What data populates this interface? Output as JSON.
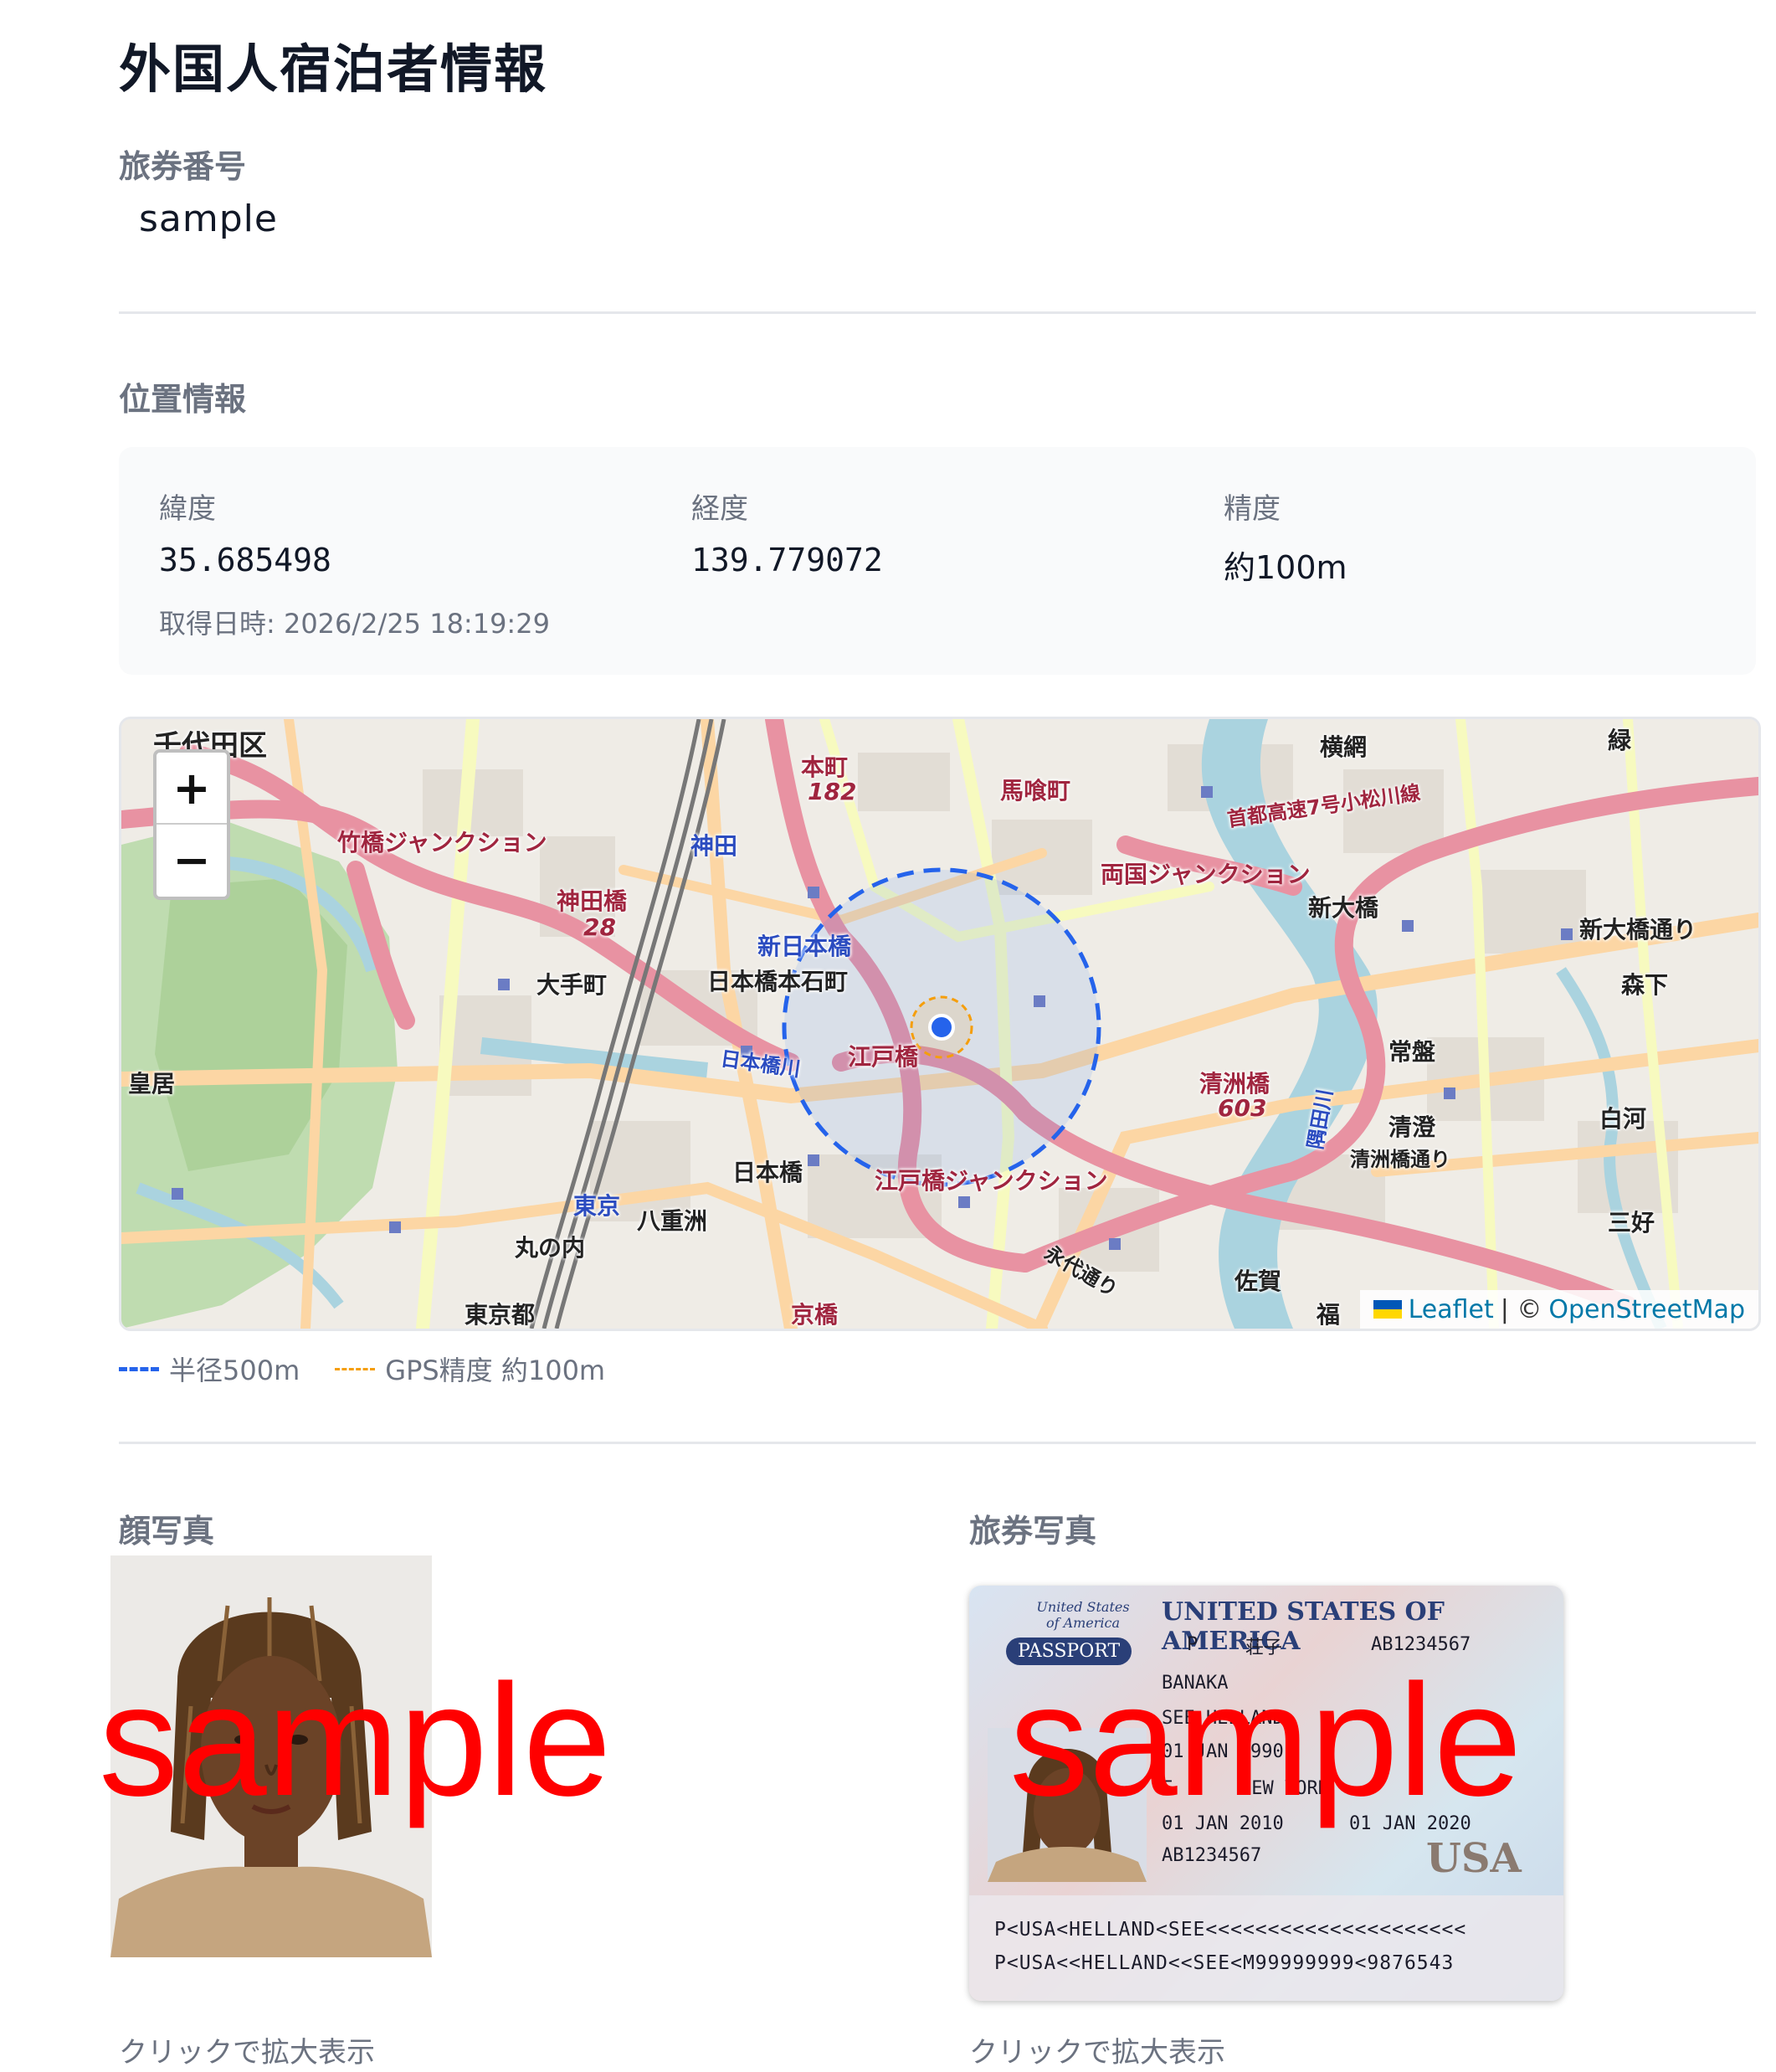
{
  "page": {
    "title": "外国人宿泊者情報"
  },
  "passport_number": {
    "label": "旅券番号",
    "value": "sample"
  },
  "location": {
    "label": "位置情報",
    "latitude_label": "緯度",
    "latitude": "35.685498",
    "longitude_label": "経度",
    "longitude": "139.779072",
    "accuracy_label": "精度",
    "accuracy": "約100m",
    "acquired_at": "取得日時: 2026/2/25 18:19:29"
  },
  "map": {
    "zoom_in": "+",
    "zoom_out": "−",
    "attribution_leaflet": "Leaflet",
    "attribution_sep": "| ©",
    "attribution_osm": "OpenStreetMap",
    "labels": {
      "chiyoda": "千代田区",
      "takebashi_jct": "竹橋ジャンクション",
      "kandabashi": "神田橋",
      "route28": "28",
      "otemachi": "大手町",
      "kokyo": "皇居",
      "marunouchi": "丸の内",
      "tokyo_st": "東京",
      "yaesu": "八重洲",
      "nihonbashi": "日本橋",
      "nihonbashi_honishicho": "日本橋本石町",
      "shin_nihonbashi": "新日本橋",
      "edobashi": "江戸橋",
      "edobashi_jct": "江戸橋ジャンクション",
      "kanda": "神田",
      "honcho": "本町",
      "route182": "182",
      "bakurocho": "馬喰町",
      "ryogoku_jct": "両国ジャンクション",
      "shin_ohashi": "新大橋",
      "shin_ohashi_dori": "新大橋通り",
      "kiyosubashi": "清洲橋",
      "route603": "603",
      "jokan": "常盤",
      "kiyosumi": "清澄",
      "kiyosubashi_dori": "清洲橋通り",
      "shirakawa": "白河",
      "miyoshi": "三好",
      "morishita": "森下",
      "midori": "緑",
      "yokoami": "横網",
      "shuto_7": "首都高速7号小松川線",
      "saga": "佐賀",
      "kyobashi": "京橋",
      "sumida_river": "隅田川",
      "nihonbashi_river": "日本橋川",
      "tokyo_to": "東京都",
      "eitai_dori": "永代通り",
      "fuku": "福"
    }
  },
  "legend": {
    "radius": "半径500m",
    "gps": "GPS精度 約100m"
  },
  "face_photo": {
    "label": "顔写真",
    "hint": "クリックで拡大表示",
    "watermark": "sample"
  },
  "passport_photo": {
    "label": "旅券写真",
    "hint": "クリックで拡大表示",
    "watermark": "sample",
    "header_country": "UNITED STATES OF AMERICA",
    "small_country": "United States of America",
    "badge": "PASSPORT",
    "passport_type": "P",
    "passport_code": "荘子",
    "passport_no": "AB1234567",
    "surname": "BANAKA",
    "given": "SEE HELLAND",
    "dob": "01 JAN 1990",
    "sex": "F",
    "place": "NEW YORK",
    "issue": "01 JAN 2010",
    "expiry": "01 JAN 2020",
    "number_bottom": "AB1234567",
    "usa": "USA",
    "mrz1": "P<USA<HELLAND<SEE<<<<<<<<<<<<<<<<<<<<<",
    "mrz2": "P<USA<<HELLAND<<SEE<M99999999<9876543"
  }
}
